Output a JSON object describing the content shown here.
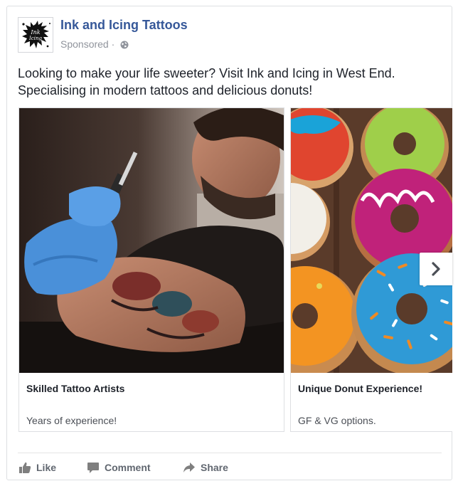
{
  "post": {
    "page_name": "Ink and Icing Tattoos",
    "sponsored_label": "Sponsored",
    "meta_separator": "·",
    "privacy_icon": "globe-icon",
    "text_line1": "Looking to make your life sweeter? Visit Ink and Icing in West End.",
    "text_line2": "Specialising in modern tattoos and delicious donuts!",
    "avatar_icon": "ink-splat-logo"
  },
  "carousel": {
    "cards": [
      {
        "title": "Skilled Tattoo Artists",
        "description": "Years of experience!",
        "image": "tattoo-artist-photo"
      },
      {
        "title": "Unique Donut Experience!",
        "description": "GF & VG options.",
        "image": "donuts-photo"
      }
    ],
    "next_icon": "chevron-right-icon"
  },
  "actions": {
    "like": "Like",
    "comment": "Comment",
    "share": "Share"
  },
  "colors": {
    "page_name": "#365899",
    "text": "#1d2129",
    "muted": "#90949c",
    "action": "#616770",
    "border": "#dddfe2"
  }
}
